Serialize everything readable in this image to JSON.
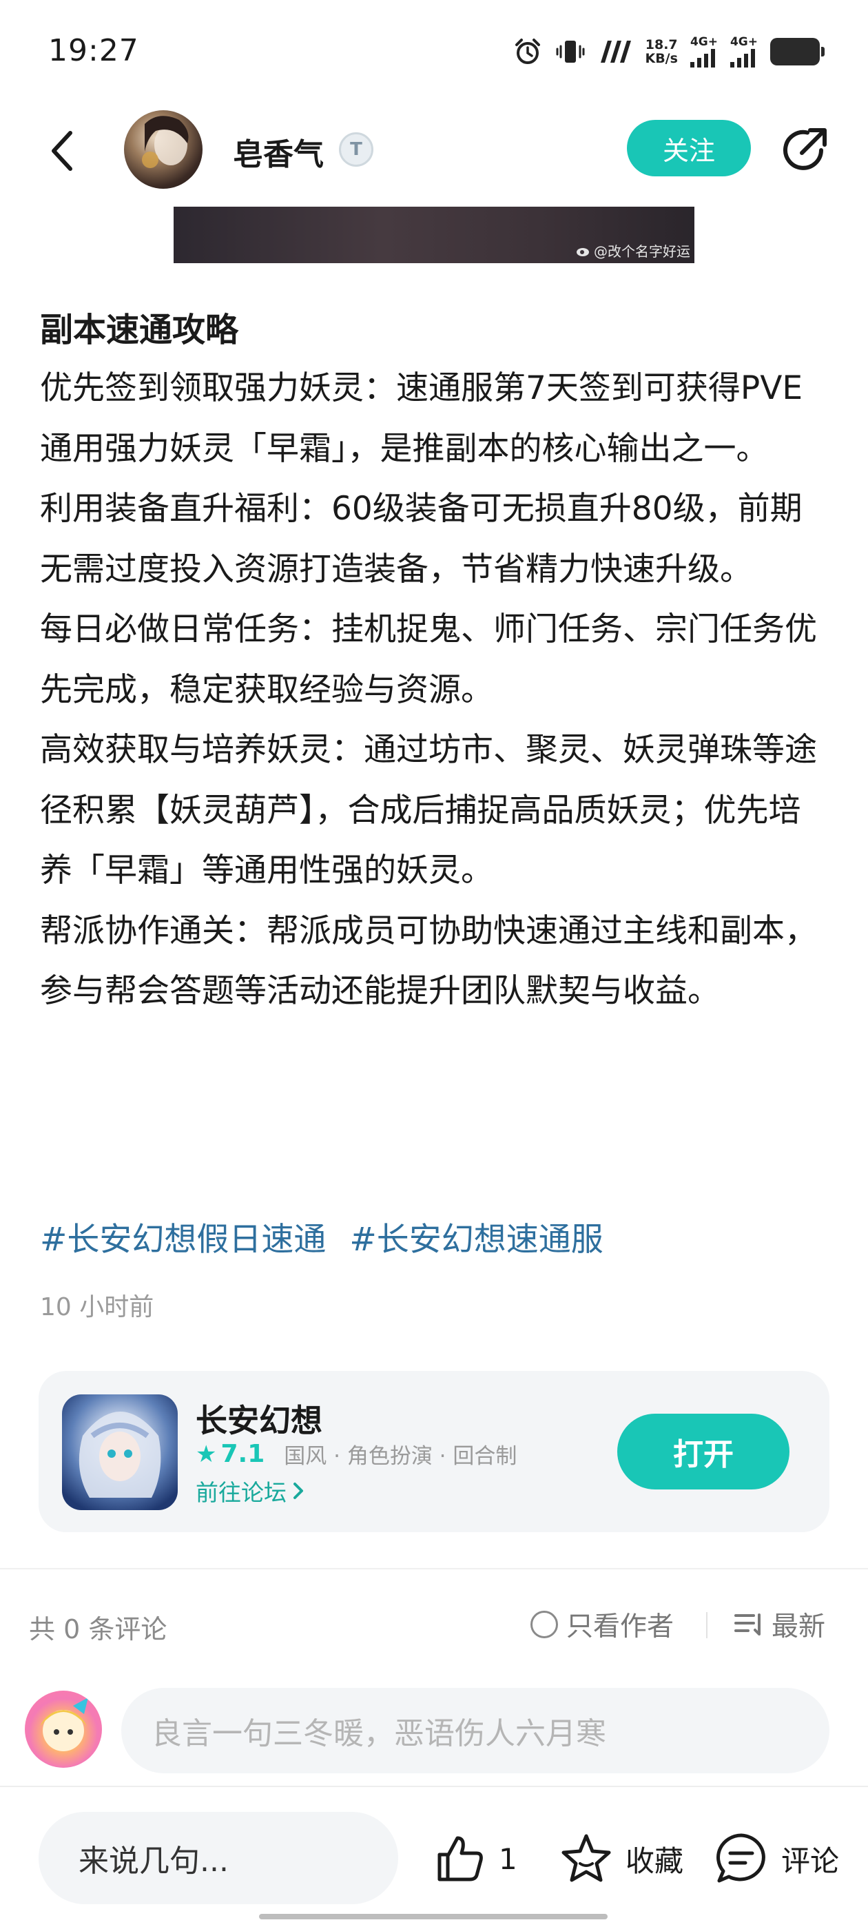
{
  "status_bar": {
    "time": "19:27",
    "net_speed_value": "18.7",
    "net_speed_unit": "KB/s",
    "signal_1": "4G+",
    "signal_2": "4G+"
  },
  "header": {
    "username": "皂香气",
    "badge": "T",
    "follow_label": "关注"
  },
  "banner": {
    "watermark": "@改个名字好运"
  },
  "article": {
    "title": "副本速通攻略",
    "paragraphs": [
      "优先签到领取强力妖灵：速通服第7天签到可获得PVE通用强力妖灵「早霜」，是推副本的核心输出之一。",
      "利用装备直升福利：60级装备可无损直升80级，前期无需过度投入资源打造装备，节省精力快速升级。",
      "每日必做日常任务：挂机捉鬼、师门任务、宗门任务优先完成，稳定获取经验与资源。",
      "高效获取与培养妖灵：通过坊市、聚灵、妖灵弹珠等途径积累【妖灵葫芦】，合成后捕捉高品质妖灵；优先培养「早霜」等通用性强的妖灵。",
      "帮派协作通关：帮派成员可协助快速通过主线和副本，参与帮会答题等活动还能提升团队默契与收益。"
    ],
    "tags": [
      "#长安幻想假日速通",
      "#长安幻想速通服"
    ],
    "time_ago": "10 小时前"
  },
  "game_card": {
    "name": "长安幻想",
    "rating": "7.1",
    "genres": "国风 · 角色扮演 · 回合制",
    "forum_link": "前往论坛",
    "open_label": "打开"
  },
  "comments": {
    "count_text": "共 0 条评论",
    "only_author_label": "只看作者",
    "sort_label": "最新",
    "input_placeholder": "良言一句三冬暖，恶语伤人六月寒"
  },
  "bottom_bar": {
    "say_placeholder": "来说几句...",
    "like_count": "1",
    "favorite_label": "收藏",
    "comment_label": "评论"
  },
  "colors": {
    "accent": "#19c6b6",
    "tag_link": "#2e6f9e",
    "muted_text": "#9a9a9a"
  },
  "icons": [
    "back-arrow-icon",
    "share-icon",
    "alarm-icon",
    "vibrate-icon",
    "nfc-icon",
    "signal-icon",
    "battery-icon",
    "star-icon",
    "chevron-right-icon",
    "radio-icon",
    "sort-lines-icon",
    "thumbs-up-icon",
    "star-outline-icon",
    "comment-bubble-icon"
  ]
}
